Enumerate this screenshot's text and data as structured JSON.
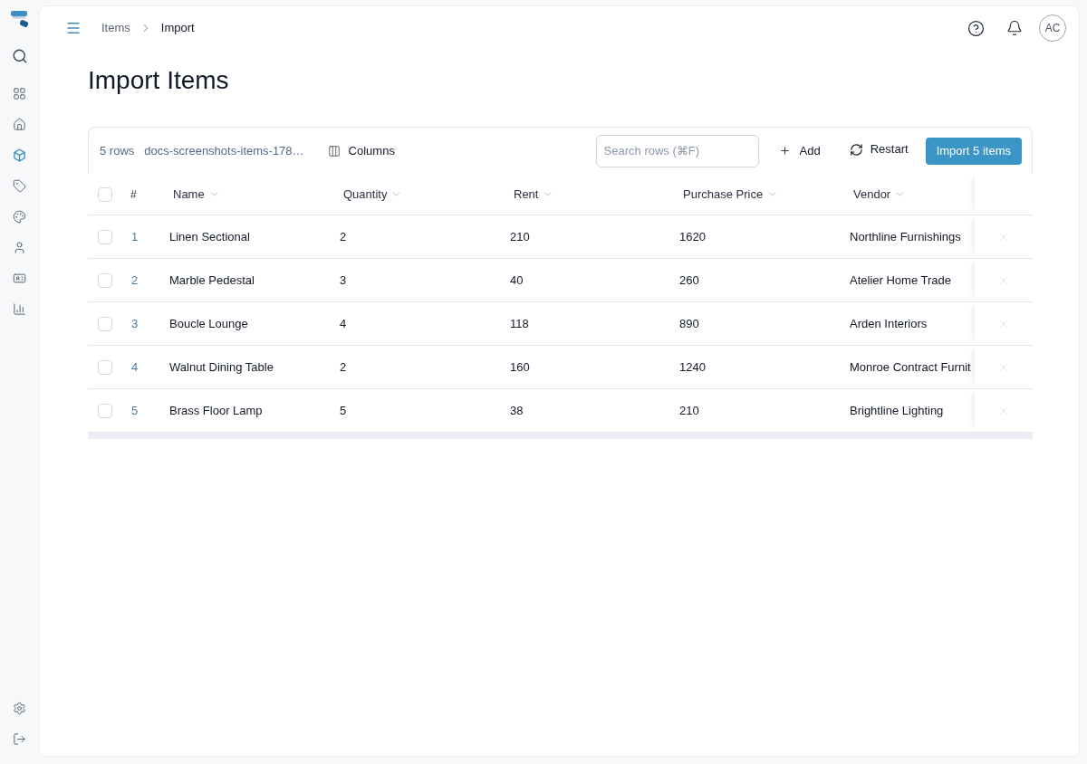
{
  "sidebar": {
    "items": [
      {
        "selected": false
      },
      {
        "selected": false
      },
      {
        "selected": true
      },
      {
        "selected": false
      },
      {
        "selected": false
      },
      {
        "selected": false
      },
      {
        "selected": false
      },
      {
        "selected": false
      }
    ]
  },
  "header": {
    "breadcrumb": [
      {
        "label": "Items",
        "current": false
      },
      {
        "label": "Import",
        "current": true
      }
    ],
    "avatar": {
      "initials": "AC"
    }
  },
  "page": {
    "title": "Import Items"
  },
  "toolbar": {
    "row_count": "5 rows",
    "file_name": "docs-screenshots-items-178…",
    "columns_button": "Columns",
    "search": {
      "placeholder": "Search rows (⌘F)"
    },
    "add_button": "Add",
    "restart_button": "Restart",
    "import_button": "Import 5 items"
  },
  "table": {
    "select_all": {
      "checked": false
    },
    "columns": [
      {
        "label": "#",
        "kind": "index"
      },
      {
        "label": "Name",
        "kind": "field"
      },
      {
        "label": "Quantity",
        "kind": "field"
      },
      {
        "label": "Rent",
        "kind": "field"
      },
      {
        "label": "Purchase Price",
        "kind": "field"
      },
      {
        "label": "Vendor",
        "kind": "field"
      }
    ],
    "rows": [
      {
        "checked": false,
        "cells": [
          "1",
          "Linen Sectional",
          "2",
          "210",
          "1620",
          "Northline Furnishings"
        ]
      },
      {
        "checked": false,
        "cells": [
          "2",
          "Marble Pedestal",
          "3",
          "40",
          "260",
          "Atelier Home Trade"
        ]
      },
      {
        "checked": false,
        "cells": [
          "3",
          "Boucle Lounge",
          "4",
          "118",
          "890",
          "Arden Interiors"
        ]
      },
      {
        "checked": false,
        "cells": [
          "4",
          "Walnut Dining Table",
          "2",
          "160",
          "1240",
          "Monroe Contract Furnit"
        ]
      },
      {
        "checked": false,
        "cells": [
          "5",
          "Brass Floor Lamp",
          "5",
          "38",
          "210",
          "Brightline Lighting"
        ]
      }
    ]
  }
}
